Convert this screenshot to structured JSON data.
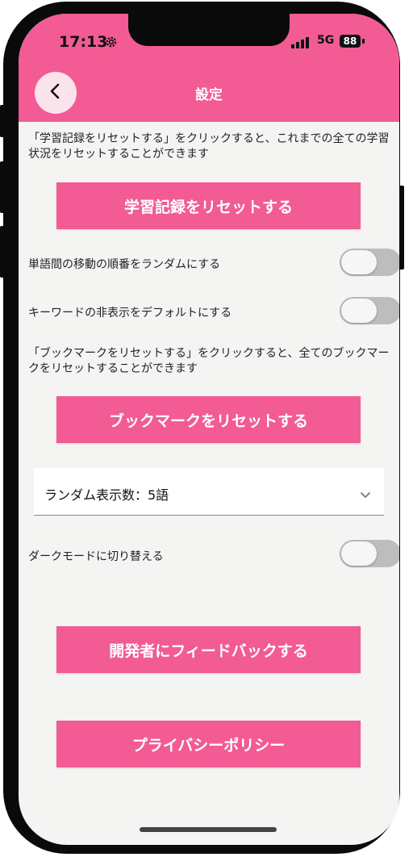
{
  "status_bar": {
    "time": "17:13",
    "network": "5G",
    "battery": "88"
  },
  "header": {
    "title": "設定"
  },
  "reset_history": {
    "description": "「学習記録をリセットする」をクリックすると、これまでの全ての学習状況をリセットすることができます",
    "button_label": "学習記録をリセットする"
  },
  "toggles": {
    "random_order": {
      "label": "単語間の移動の順番をランダムにする",
      "on": false
    },
    "hide_keywords": {
      "label": "キーワードの非表示をデフォルトにする",
      "on": false
    },
    "dark_mode": {
      "label": "ダークモードに切り替える",
      "on": false
    }
  },
  "reset_bookmarks": {
    "description": "「ブックマークをリセットする」をクリックすると、全てのブックマークをリセットすることができます",
    "button_label": "ブックマークをリセットする"
  },
  "random_count": {
    "selected": "ランダム表示数：5語"
  },
  "feedback": {
    "button_label": "開発者にフィードバックする"
  },
  "privacy": {
    "button_label": "プライバシーポリシー"
  },
  "colors": {
    "accent": "#f25b93",
    "background": "#f4f4f3",
    "toggle_off": "#bdbdbd"
  }
}
